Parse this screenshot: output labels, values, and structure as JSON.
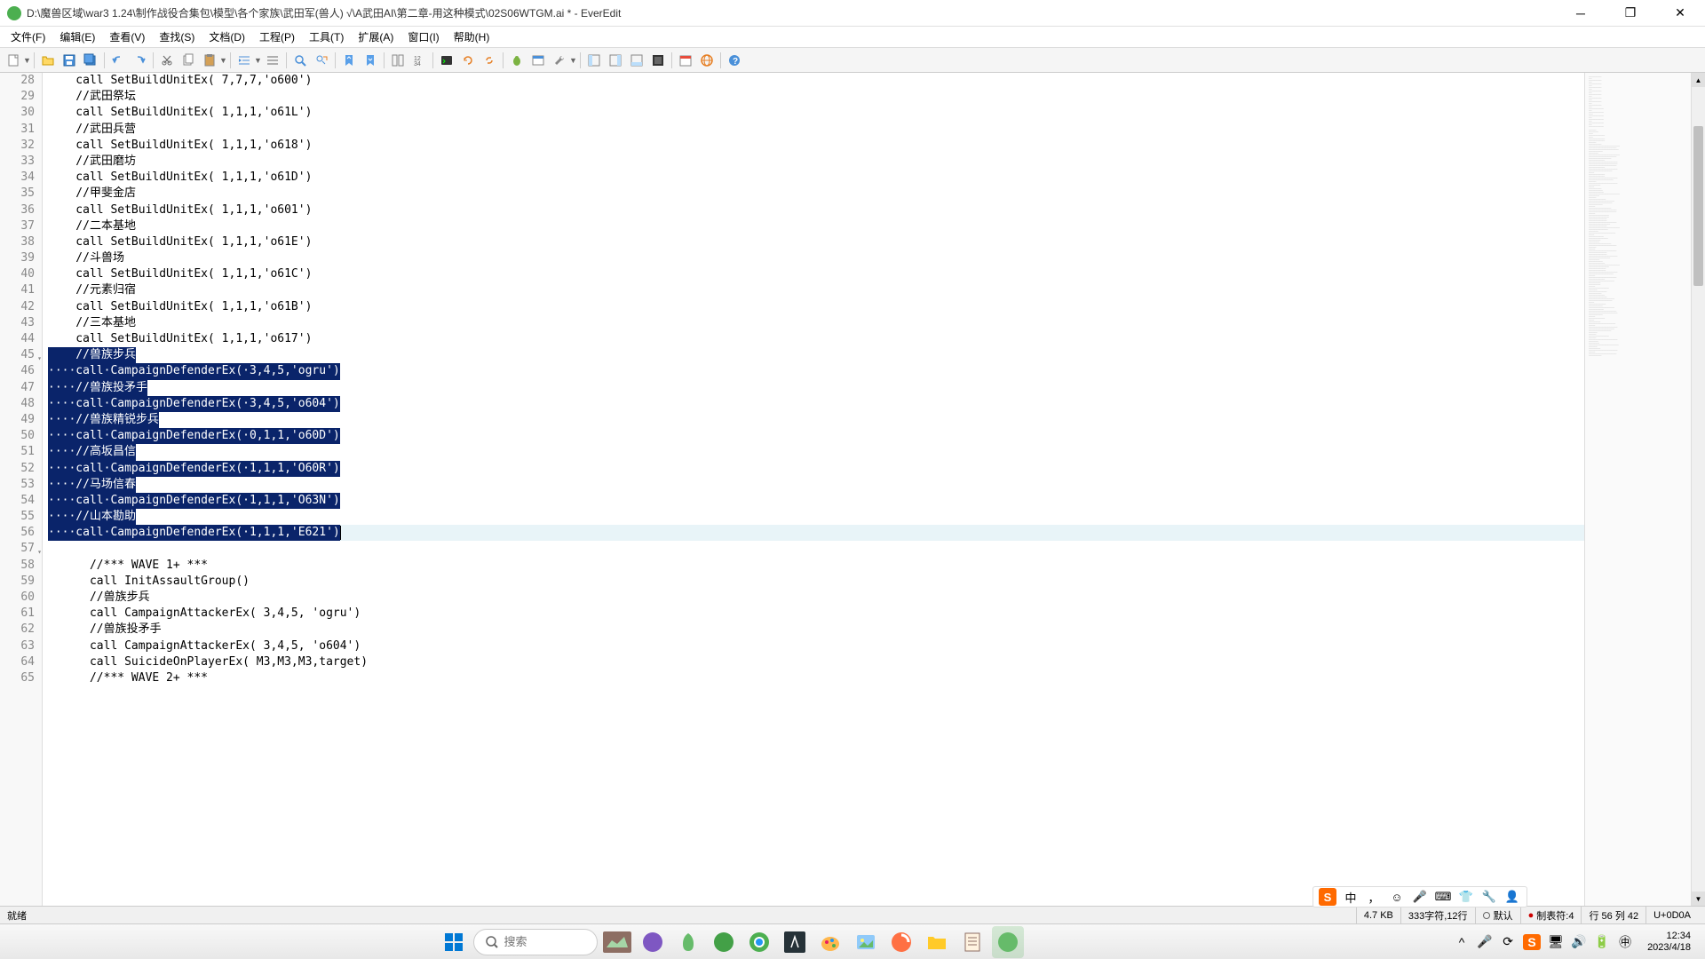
{
  "window": {
    "title": "D:\\魔兽区域\\war3 1.24\\制作战役合集包\\模型\\各个家族\\武田军(兽人)    √\\A武田AI\\第二章-用这种模式\\02S06WTGM.ai * - EverEdit"
  },
  "menu": {
    "file": "文件(F)",
    "edit": "编辑(E)",
    "view": "查看(V)",
    "search": "查找(S)",
    "document": "文档(D)",
    "project": "工程(P)",
    "tools": "工具(T)",
    "extension": "扩展(A)",
    "window": "窗口(I)",
    "help": "帮助(H)"
  },
  "code": {
    "lines": [
      {
        "num": "28",
        "text": "    call SetBuildUnitEx( 7,7,7,'o600')",
        "selected": false
      },
      {
        "num": "29",
        "text": "    //武田祭坛",
        "selected": false
      },
      {
        "num": "30",
        "text": "    call SetBuildUnitEx( 1,1,1,'o61L')",
        "selected": false
      },
      {
        "num": "31",
        "text": "    //武田兵营",
        "selected": false
      },
      {
        "num": "32",
        "text": "    call SetBuildUnitEx( 1,1,1,'o618')",
        "selected": false
      },
      {
        "num": "33",
        "text": "    //武田磨坊",
        "selected": false
      },
      {
        "num": "34",
        "text": "    call SetBuildUnitEx( 1,1,1,'o61D')",
        "selected": false
      },
      {
        "num": "35",
        "text": "    //甲斐金店",
        "selected": false
      },
      {
        "num": "36",
        "text": "    call SetBuildUnitEx( 1,1,1,'o601')",
        "selected": false
      },
      {
        "num": "37",
        "text": "    //二本基地",
        "selected": false
      },
      {
        "num": "38",
        "text": "    call SetBuildUnitEx( 1,1,1,'o61E')",
        "selected": false
      },
      {
        "num": "39",
        "text": "    //斗兽场",
        "selected": false
      },
      {
        "num": "40",
        "text": "    call SetBuildUnitEx( 1,1,1,'o61C')",
        "selected": false
      },
      {
        "num": "41",
        "text": "    //元素归宿",
        "selected": false
      },
      {
        "num": "42",
        "text": "    call SetBuildUnitEx( 1,1,1,'o61B')",
        "selected": false
      },
      {
        "num": "43",
        "text": "    //三本基地",
        "selected": false
      },
      {
        "num": "44",
        "text": "    call SetBuildUnitEx( 1,1,1,'o617')",
        "selected": false
      },
      {
        "num": "45",
        "text": "    //兽族步兵",
        "selected": true,
        "fold": true
      },
      {
        "num": "46",
        "text": "····call·CampaignDefenderEx(·3,4,5,'ogru')",
        "selected": true
      },
      {
        "num": "47",
        "text": "····//兽族投矛手",
        "selected": true
      },
      {
        "num": "48",
        "text": "····call·CampaignDefenderEx(·3,4,5,'o604')",
        "selected": true
      },
      {
        "num": "49",
        "text": "····//兽族精锐步兵",
        "selected": true
      },
      {
        "num": "50",
        "text": "····call·CampaignDefenderEx(·0,1,1,'o60D')",
        "selected": true
      },
      {
        "num": "51",
        "text": "····//高坂昌信",
        "selected": true
      },
      {
        "num": "52",
        "text": "····call·CampaignDefenderEx(·1,1,1,'O60R')",
        "selected": true
      },
      {
        "num": "53",
        "text": "····//马场信春",
        "selected": true
      },
      {
        "num": "54",
        "text": "····call·CampaignDefenderEx(·1,1,1,'O63N')",
        "selected": true
      },
      {
        "num": "55",
        "text": "····//山本勘助",
        "selected": true
      },
      {
        "num": "56",
        "text": "····call·CampaignDefenderEx(·1,1,1,'E621')",
        "selected": true,
        "current": true
      },
      {
        "num": "57",
        "text": "",
        "selected": false,
        "fold": true
      },
      {
        "num": "58",
        "text": "      //*** WAVE 1+ ***",
        "selected": false
      },
      {
        "num": "59",
        "text": "      call InitAssaultGroup()",
        "selected": false
      },
      {
        "num": "60",
        "text": "      //兽族步兵",
        "selected": false
      },
      {
        "num": "61",
        "text": "      call CampaignAttackerEx( 3,4,5, 'ogru')",
        "selected": false
      },
      {
        "num": "62",
        "text": "      //兽族投矛手",
        "selected": false
      },
      {
        "num": "63",
        "text": "      call CampaignAttackerEx( 3,4,5, 'o604')",
        "selected": false
      },
      {
        "num": "64",
        "text": "      call SuicideOnPlayerEx( M3,M3,M3,target)",
        "selected": false
      },
      {
        "num": "65",
        "text": "      //*** WAVE 2+ ***",
        "selected": false
      }
    ]
  },
  "status": {
    "ready": "就绪",
    "size": "4.7 KB",
    "selection": "333字符,12行",
    "default": "默认",
    "tabwidth": "制表符:4",
    "position": "行 56  列 42",
    "encoding": "U+0D0A"
  },
  "search": {
    "placeholder": "搜索"
  },
  "clock": {
    "time": "12:34",
    "date": "2023/4/18"
  },
  "ime": {
    "label": "中"
  }
}
